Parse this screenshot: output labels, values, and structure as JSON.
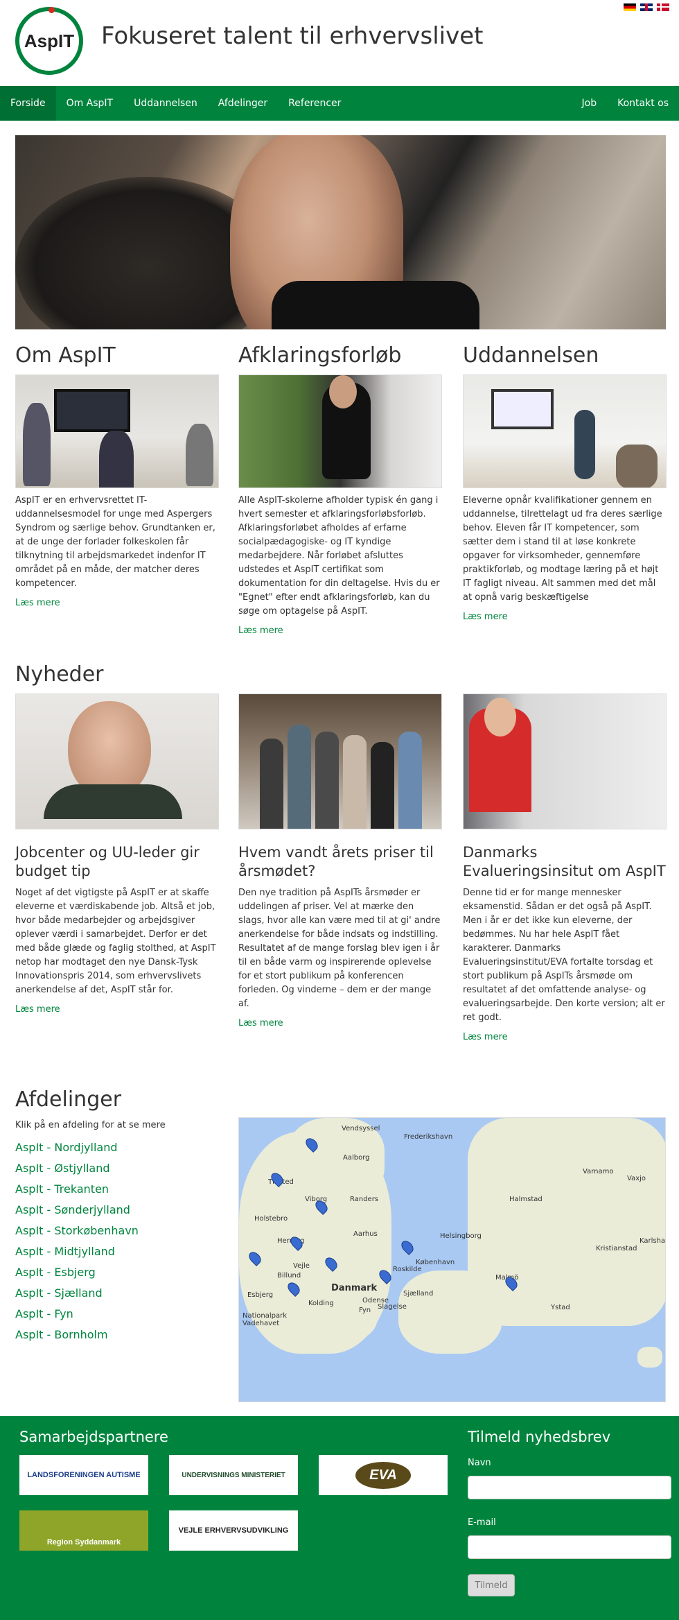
{
  "header": {
    "logo_text": "AspIT",
    "title": "Fokuseret talent til erhvervslivet"
  },
  "languages": [
    "Deutsch",
    "English",
    "Dansk"
  ],
  "nav": {
    "left": [
      "Forside",
      "Om AspIT",
      "Uddannelsen",
      "Afdelinger",
      "Referencer"
    ],
    "right": [
      "Job",
      "Kontakt os"
    ],
    "active": "Forside"
  },
  "sections": [
    {
      "title": "Om AspIT",
      "text": "AspIT er en erhvervsrettet IT-uddannelsesmodel for unge med Aspergers Syndrom og særlige behov. Grundtanken er, at de unge der forlader folkeskolen får tilknytning til arbejdsmarkedet indenfor IT området på en måde, der matcher deres kompetencer.",
      "link": "Læs mere"
    },
    {
      "title": "Afklaringsforløb",
      "text": "Alle AspIT-skolerne afholder typisk én gang i hvert semester et afklaringsforløbsforløb. Afklaringsforløbet afholdes af erfarne socialpædagogiske- og IT kyndige medarbejdere. Når forløbet afsluttes udstedes et AspIT certifikat som dokumentation for din deltagelse. Hvis du er \"Egnet\" efter endt afklaringsforløb, kan du søge om optagelse på AspIT.",
      "link": "Læs mere"
    },
    {
      "title": "Uddannelsen",
      "text": "Eleverne opnår kvalifikationer gennem en uddannelse, tilrettelagt ud fra deres særlige behov. Eleven får IT kompetencer, som sætter dem i stand til at løse konkrete opgaver for virksomheder, gennemføre praktikforløb, og modtage læring på et højt IT fagligt niveau. Alt sammen med det mål at opnå varig beskæftigelse",
      "link": "Læs mere"
    }
  ],
  "news": {
    "title": "Nyheder",
    "items": [
      {
        "headline": "Jobcenter og UU-leder gir budget tip",
        "text": "Noget af det vigtigste på AspIT er at skaffe eleverne et værdiskabende job. Altså et job, hvor både medarbejder og arbejdsgiver oplever værdi i samarbejdet. Derfor er det med både glæde og faglig stolthed, at AspIT netop har modtaget den nye Dansk-Tysk Innovationspris 2014, som erhvervslivets anerkendelse af det, AspIT står for.",
        "link": "Læs mere"
      },
      {
        "headline": "Hvem vandt årets priser til årsmødet?",
        "text": "Den nye tradition på AspITs årsmøder er uddelingen af priser. Vel at mærke den slags, hvor alle kan være med til at gi' andre anerkendelse for både indsats og indstilling. Resultatet af de mange forslag blev igen i år til en både varm og inspirerende oplevelse for et stort publikum på konferencen forleden. Og vinderne – dem er der mange af.",
        "link": "Læs mere"
      },
      {
        "headline": "Danmarks Evalueringsinsitut om AspIT",
        "text": "Denne tid er for mange mennesker eksamenstid. Sådan er det også på AspIT. Men i år er det ikke kun eleverne, der bedømmes. Nu har hele AspIT fået karakterer. Danmarks Evalueringsinstitut/EVA fortalte torsdag et stort publikum på AspITs årsmøde om resultatet af det omfattende analyse- og evalueringsarbejde. Den korte version; alt er ret godt.",
        "link": "Læs mere"
      }
    ]
  },
  "departments": {
    "title": "Afdelinger",
    "intro": "Klik på en afdeling for at se mere",
    "items": [
      "AspIt - Nordjylland",
      "AspIt - Østjylland",
      "AspIt - Trekanten",
      "AspIt - Sønderjylland",
      "AspIt - Storkøbenhavn",
      "AspIt - Midtjylland",
      "AspIt - Esbjerg",
      "AspIt - Sjælland",
      "AspIt - Fyn",
      "AspIt - Bornholm"
    ]
  },
  "map": {
    "labels": [
      "Aalborg",
      "Thisted",
      "Viborg",
      "Randers",
      "Holstebro",
      "Herning",
      "Aarhus",
      "Vejle",
      "Esbjerg",
      "Kolding",
      "Odense",
      "Danmark",
      "Helsingborg",
      "København",
      "Malmö",
      "Roskilde",
      "Sjælland",
      "Slagelse",
      "Fyn",
      "Halmstad",
      "Kristianstad",
      "Varnamo",
      "Vaxjo",
      "Karlshamn",
      "Ystad",
      "Frederikshavn",
      "Vendsyssel",
      "Nationalpark Vadehavet",
      "Billund"
    ]
  },
  "footer": {
    "partners_title": "Samarbejdspartnere",
    "partners": [
      "LANDSFORENINGEN AUTISME",
      "UNDERVISNINGS MINISTERIET",
      "EVA",
      "Region Syddanmark",
      "VEJLE ERHVERVSUDVIKLING"
    ],
    "newsletter_title": "Tilmeld nyhedsbrev",
    "name_label": "Navn",
    "email_label": "E-mail",
    "submit": "Tilmeld"
  }
}
